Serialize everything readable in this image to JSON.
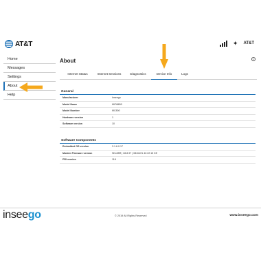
{
  "header": {
    "brand": "AT&T",
    "carrier_label": "AT&T",
    "signal_bars": 4
  },
  "sidebar": {
    "items": [
      {
        "label": "Home"
      },
      {
        "label": "Messages"
      },
      {
        "label": "Settings"
      },
      {
        "label": "About",
        "active": true
      },
      {
        "label": "Help"
      }
    ]
  },
  "main": {
    "title": "About",
    "help_glyph": "?",
    "tabs": [
      {
        "label": "Internet Status"
      },
      {
        "label": "Internet Sessions"
      },
      {
        "label": "Diagnostics"
      },
      {
        "label": "Device Info",
        "active": true
      },
      {
        "label": "Logs"
      }
    ],
    "general": {
      "title": "General",
      "rows": [
        {
          "key": "Manufacturer",
          "value": "Inseego"
        },
        {
          "key": "Model Name",
          "value": "MiFi8800"
        },
        {
          "key": "Model Number",
          "value": "MC800"
        },
        {
          "key": "Hardware version",
          "value": "1"
        },
        {
          "key": "Software version",
          "value": "10"
        }
      ]
    },
    "software": {
      "title": "Software Components",
      "rows": [
        {
          "key": "Embedded OS version",
          "value": "3.1.6.0.17"
        },
        {
          "key": "Modem Firmware version",
          "value": "SDx55R | 28.8.97 | 08/16/21 42:22:15 KE"
        },
        {
          "key": "PRI version",
          "value": "118"
        }
      ]
    }
  },
  "footer": {
    "logo_main": "insee",
    "logo_accent": "go",
    "copyright": "© 2019 All Rights Reserved",
    "site": "www.inseego.com"
  },
  "colors": {
    "accent": "#1a6fb5",
    "annotation_arrow": "#f5a81c",
    "logo_go": "#1d92d0"
  }
}
